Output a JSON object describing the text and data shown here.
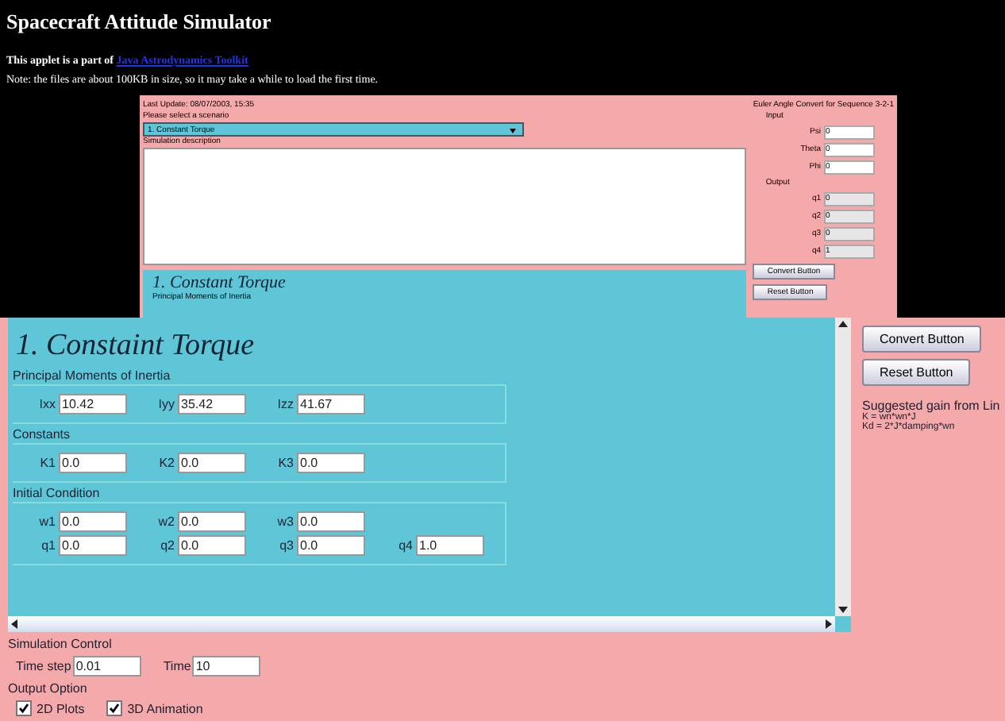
{
  "page": {
    "title": "Spacecraft Attitude Simulator",
    "intro": "This applet is a part of ",
    "intro_link": "Java Astrodynamics Toolkit",
    "note": "Note: the files are about 100KB in size, so it may take a while to load the first time."
  },
  "background_applet": {
    "update": "Last Update: 08/07/2003, 15:35",
    "prompt": "Please select a scenario",
    "scenario": "1. Constant Torque",
    "description_label": "Simulation description",
    "panel_title": "1. Constant Torque",
    "panel_subtitle": "Principal Moments of Inertia",
    "converter": {
      "title": "Euler Angle Convert for Sequence 3-2-1",
      "input_label": "Input",
      "inputs": [
        {
          "label": "Psi",
          "value": "0"
        },
        {
          "label": "Theta",
          "value": "0"
        },
        {
          "label": "Phi",
          "value": "0"
        }
      ],
      "output_label": "Output",
      "outputs": [
        {
          "label": "q1",
          "value": "0"
        },
        {
          "label": "q2",
          "value": "0"
        },
        {
          "label": "q3",
          "value": "0"
        },
        {
          "label": "q4",
          "value": "1"
        }
      ],
      "buttons": [
        "Convert Button",
        "Reset Button"
      ]
    }
  },
  "applet": {
    "title": "1. Constaint Torque",
    "sections": [
      {
        "heading": "Principal Moments of Inertia",
        "rows": [
          [
            {
              "label": "Ixx",
              "value": "10.42"
            },
            {
              "label": "Iyy",
              "value": "35.42"
            },
            {
              "label": "Izz",
              "value": "41.67"
            }
          ]
        ]
      },
      {
        "heading": "Constants",
        "rows": [
          [
            {
              "label": "K1",
              "value": "0.0"
            },
            {
              "label": "K2",
              "value": "0.0"
            },
            {
              "label": "K3",
              "value": "0.0"
            }
          ]
        ]
      },
      {
        "heading": "Initial Condition",
        "rows": [
          [
            {
              "label": "w1",
              "value": "0.0"
            },
            {
              "label": "w2",
              "value": "0.0"
            },
            {
              "label": "w3",
              "value": "0.0"
            }
          ],
          [
            {
              "label": "q1",
              "value": "0.0"
            },
            {
              "label": "q2",
              "value": "0.0"
            },
            {
              "label": "q3",
              "value": "0.0"
            },
            {
              "label": "q4",
              "value": "1.0"
            }
          ]
        ]
      }
    ],
    "buttons": [
      "Convert Button",
      "Reset Button"
    ],
    "gain_title": "Suggested gain from Lin",
    "gain_lines": [
      "K = wn*wn*J",
      "Kd = 2*J*damping*wn"
    ],
    "simulation_control": {
      "heading": "Simulation Control",
      "fields": [
        {
          "label": "Time step",
          "value": "0.01"
        },
        {
          "label": "Time",
          "value": "10"
        }
      ]
    },
    "output_option": {
      "heading": "Output Option",
      "options": [
        {
          "label": "2D Plots",
          "checked": true
        },
        {
          "label": "3D Animation",
          "checked": true
        }
      ]
    }
  }
}
